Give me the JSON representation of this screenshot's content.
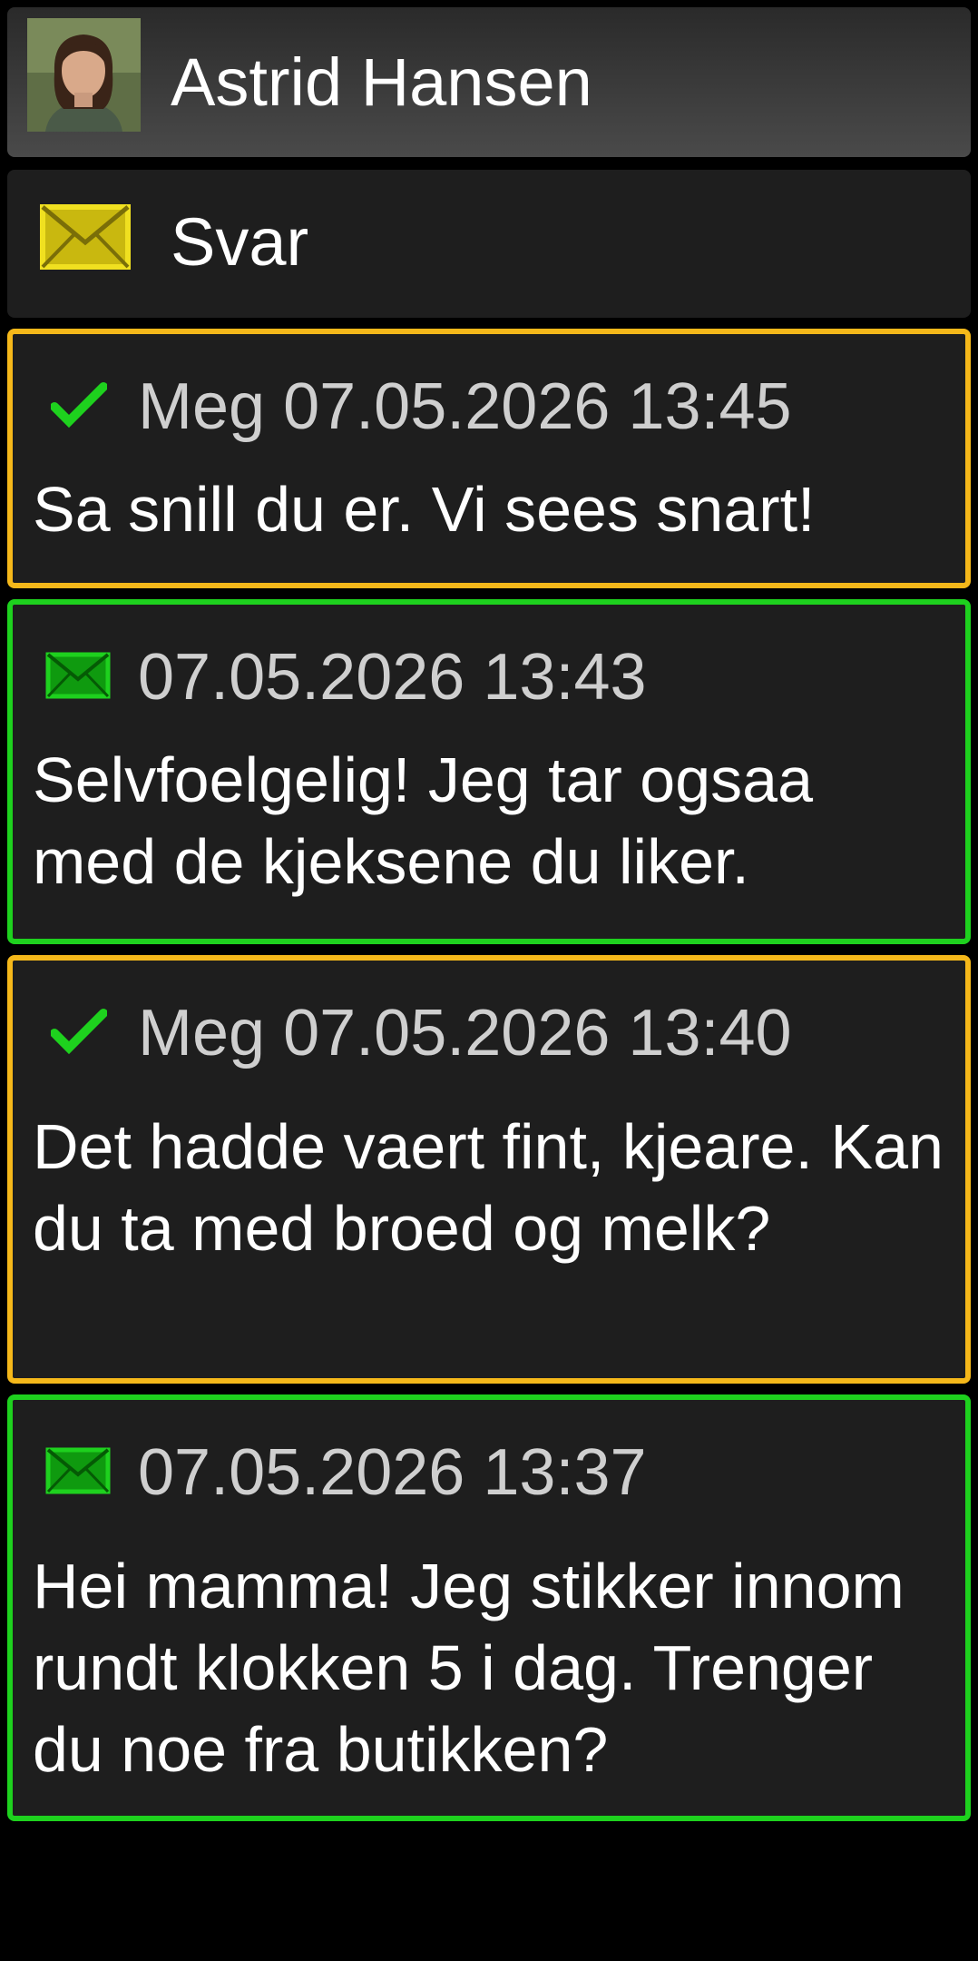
{
  "contact": {
    "name": "Astrid Hansen",
    "avatar_icon": "person-photo"
  },
  "reply": {
    "label": "Svar",
    "icon": "envelope-icon",
    "icon_color": "#f0e020"
  },
  "colors": {
    "sent_border": "#f5b81a",
    "received_border": "#1ed11e",
    "check": "#1ed11e",
    "received_icon": "#1ed11e"
  },
  "messages": [
    {
      "direction": "sent",
      "status_icon": "checkmark-icon",
      "meta": "Meg 07.05.2026 13:45",
      "text": "Sa snill du er. Vi sees snart!"
    },
    {
      "direction": "received",
      "status_icon": "envelope-icon",
      "meta": "07.05.2026 13:43",
      "text": "Selvfoelgelig! Jeg tar ogsaa med de kjeksene du liker."
    },
    {
      "direction": "sent",
      "status_icon": "checkmark-icon",
      "meta": "Meg 07.05.2026 13:40",
      "text": "Det hadde vaert fint, kjeare. Kan du ta med broed og melk?"
    },
    {
      "direction": "received",
      "status_icon": "envelope-icon",
      "meta": "07.05.2026 13:37",
      "text": "Hei mamma! Jeg stikker innom rundt klokken 5 i dag. Trenger du noe fra butikken?"
    }
  ]
}
